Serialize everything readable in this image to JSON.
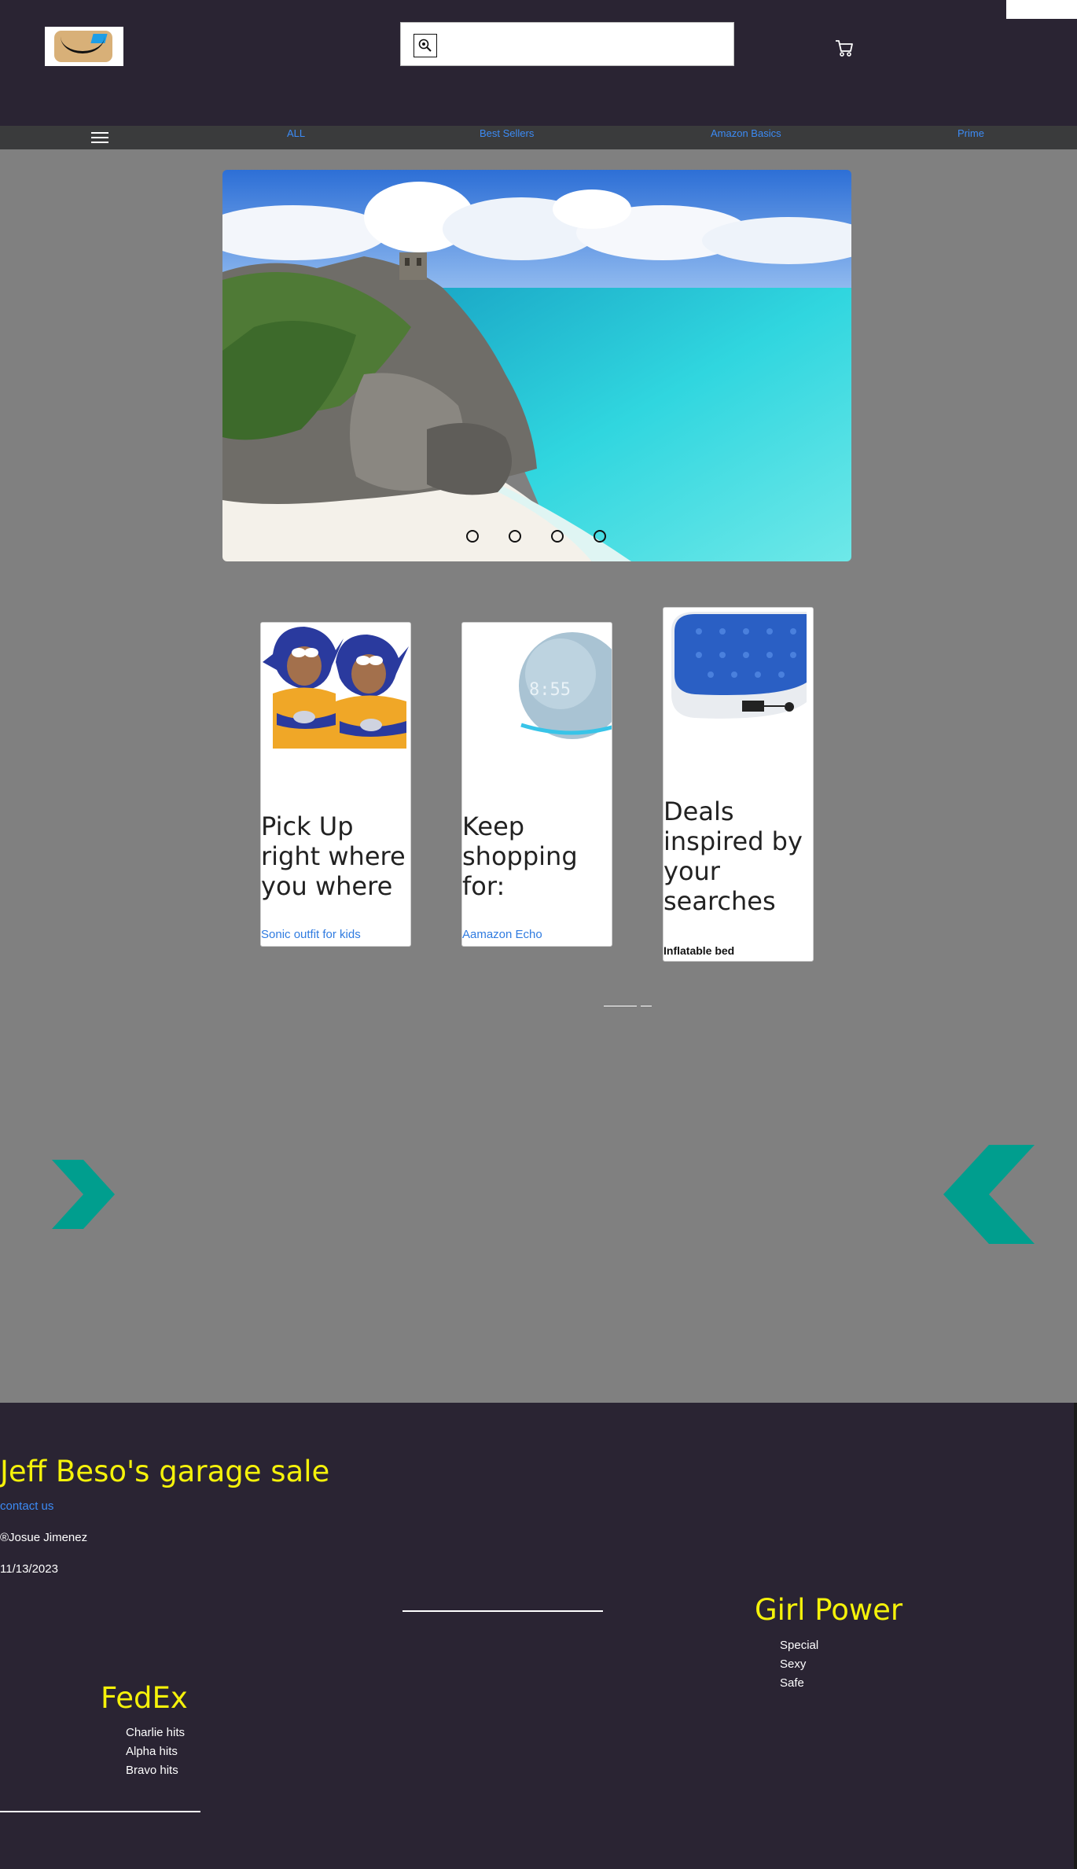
{
  "header": {
    "search_placeholder": "",
    "logo_alt": "amazon-box-logo",
    "cart_icon": "cart-icon"
  },
  "nav": {
    "menu_icon": "hamburger-icon",
    "links": [
      "ALL",
      "Best Sellers",
      "Amazon Basics",
      "Prime"
    ]
  },
  "hero": {
    "image": "tropical beach with cliffs and ruins",
    "dots": 4
  },
  "cards": [
    {
      "title": "Pick Up right where you where",
      "link": "Sonic outfit for kids"
    },
    {
      "title": "Keep shopping for:",
      "link": "Aamazon Echo"
    },
    {
      "title": "Deals inspired by your searches",
      "caption": "Inflatable bed"
    }
  ],
  "arrows": {
    "color": "#009e8e"
  },
  "footer": {
    "title": "Jeff Beso's garage sale",
    "contact": "contact us",
    "copyright": "®Josue Jimenez",
    "date": "11/13/2023",
    "section_right": {
      "heading": "Girl Power",
      "items": [
        "Special",
        "Sexy",
        "Safe"
      ]
    },
    "section_left": {
      "heading": "FedEx",
      "items": [
        "Charlie hits",
        "Alpha hits",
        "Bravo hits"
      ]
    }
  },
  "colors": {
    "header_bg": "#2a2433",
    "nav_bg": "#3a3b3c",
    "page_bg": "#808080",
    "link": "#3c8bf5",
    "footer_heading": "#f5f20a"
  }
}
